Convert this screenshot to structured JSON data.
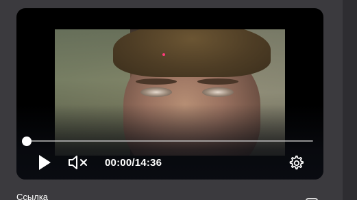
{
  "player": {
    "current_time": "00:00",
    "separator": "/",
    "duration": "14:36",
    "progress_fraction": 0.0,
    "muted": true,
    "icons": {
      "play": "play-icon",
      "mute": "volume-muted-icon",
      "settings": "gear-icon"
    }
  },
  "below": {
    "link_label": "Ссылка"
  },
  "colors": {
    "page_background": "#3b3a3e",
    "player_background": "#000000",
    "progress_fill": "#ffffff",
    "progress_track": "#c8c8c8"
  }
}
